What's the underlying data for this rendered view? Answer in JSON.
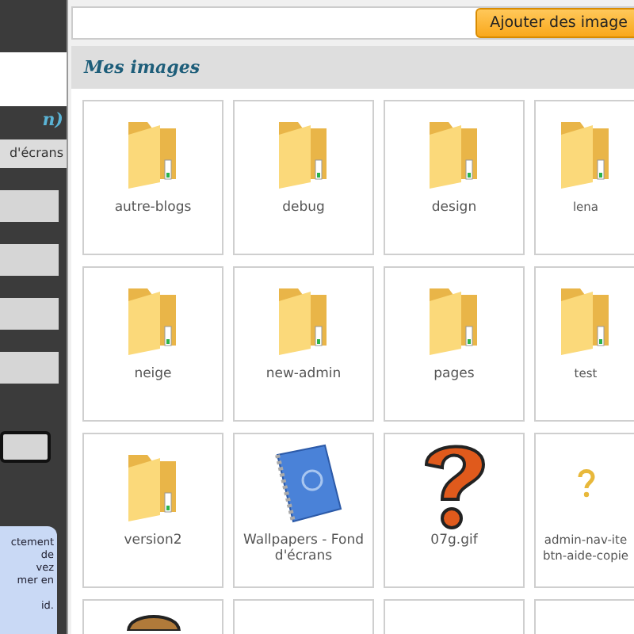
{
  "sidebar": {
    "heading": "n)",
    "file_button": "d'écrans",
    "bars": [
      {
        "kind": "bar"
      },
      {
        "kind": "bar"
      },
      {
        "kind": "bar"
      },
      {
        "kind": "bar"
      },
      {
        "kind": "outlined"
      }
    ],
    "info_lines": [
      "ctement",
      "de",
      "vez",
      "mer en",
      "id."
    ]
  },
  "toolbar": {
    "add_button": "Ajouter des image"
  },
  "section_title": "Mes images",
  "tiles": [
    {
      "kind": "folder",
      "label": "autre-blogs"
    },
    {
      "kind": "folder",
      "label": "debug"
    },
    {
      "kind": "folder",
      "label": "design"
    },
    {
      "kind": "folder",
      "label": "lena"
    },
    {
      "kind": "folder",
      "label": "neige"
    },
    {
      "kind": "folder",
      "label": "new-admin"
    },
    {
      "kind": "folder",
      "label": "pages"
    },
    {
      "kind": "folder",
      "label": "test"
    },
    {
      "kind": "folder",
      "label": "version2"
    },
    {
      "kind": "notebook",
      "label": "Wallpapers - Fond d'écrans"
    },
    {
      "kind": "question-big",
      "label": "07g.gif"
    },
    {
      "kind": "question-small",
      "label": "admin-nav-ite btn-aide-copie"
    },
    {
      "kind": "box"
    },
    {
      "kind": "empty"
    },
    {
      "kind": "empty"
    },
    {
      "kind": "empty"
    }
  ]
}
